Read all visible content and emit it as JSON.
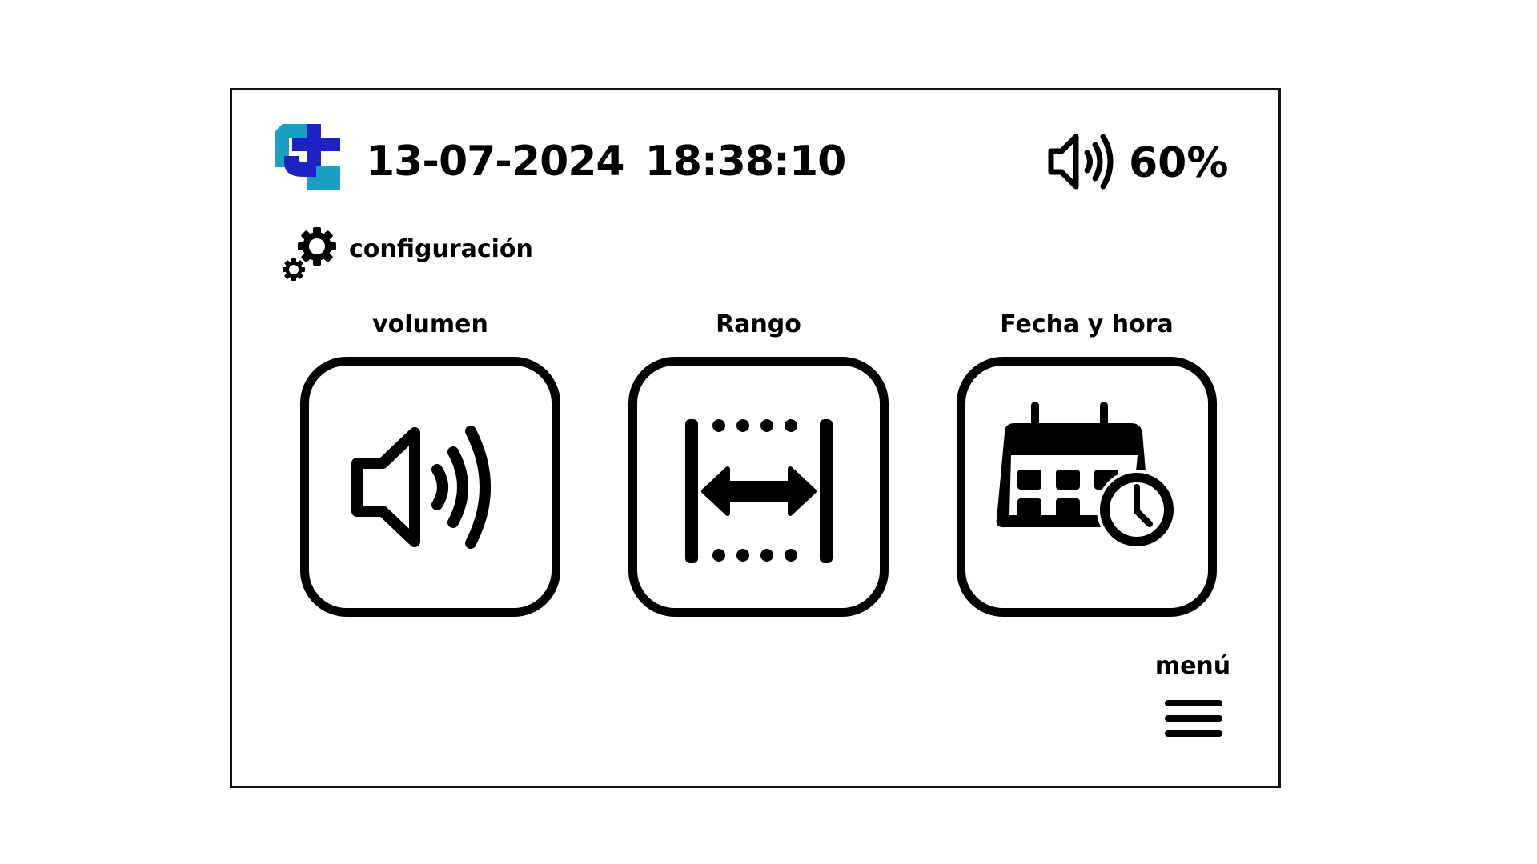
{
  "header": {
    "date": "13-07-2024",
    "time": "18:38:10",
    "volume_percent": "60%",
    "volume_value": 60
  },
  "config": {
    "label": "configuración"
  },
  "tiles": [
    {
      "label": "volumen",
      "icon": "speaker-icon"
    },
    {
      "label": "Rango",
      "icon": "range-arrows-icon"
    },
    {
      "label": "Fecha y hora",
      "icon": "calendar-clock-icon"
    }
  ],
  "menu": {
    "label": "menú",
    "icon": "hamburger-icon"
  },
  "colors": {
    "logo_light": "#1ba0c4",
    "logo_dark": "#1e22c4",
    "foreground": "#000000"
  }
}
